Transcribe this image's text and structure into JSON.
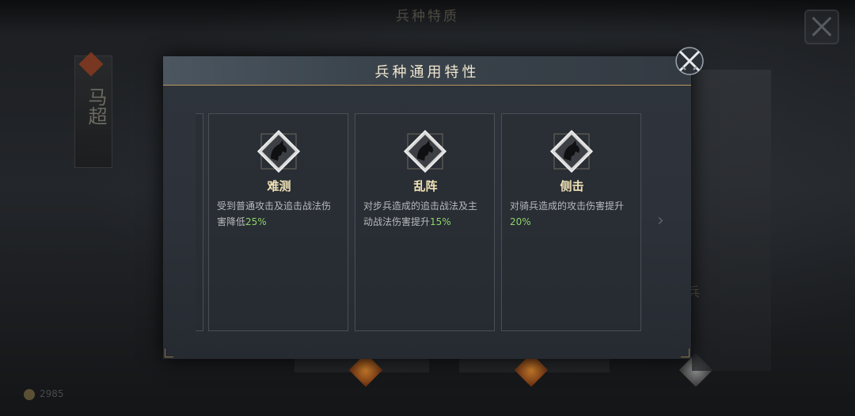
{
  "background": {
    "title": "兵种特质",
    "banner_text": "马超",
    "right_card_label": "骑兵",
    "coins": "2985"
  },
  "modal": {
    "title": "兵种通用特性",
    "cards": [
      {
        "name": "难测",
        "desc_line1": "受到普通攻击及追击战法伤",
        "desc_line2": "害降低",
        "pct": "25%",
        "icon": "horse-icon"
      },
      {
        "name": "乱阵",
        "desc_line1": "对步兵造成的追击战法及主",
        "desc_line2": "动战法伤害提升",
        "pct": "15%",
        "icon": "horse-icon"
      },
      {
        "name": "侧击",
        "desc_line1": "对骑兵造成的攻击伤害提升",
        "desc_line2": "",
        "pct": "20%",
        "icon": "horse-icon"
      }
    ]
  },
  "colors": {
    "title": "#efe6cf",
    "trait_name": "#f0e2b6",
    "percent": "#8fd36a",
    "gold_border": "#b6975b"
  }
}
